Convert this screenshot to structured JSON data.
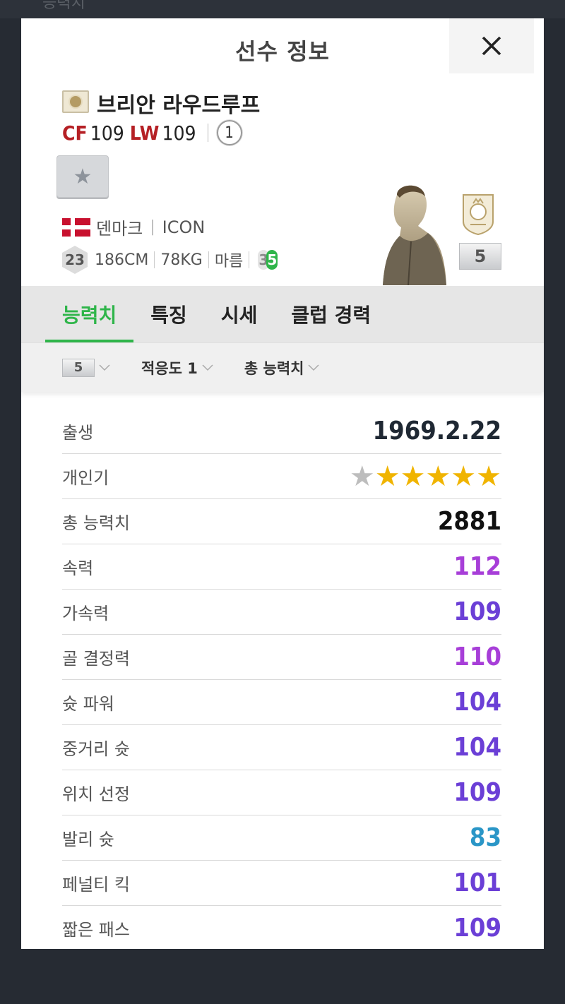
{
  "background": {
    "title_fragment": "능력치"
  },
  "modal": {
    "title": "선수 정보"
  },
  "player": {
    "name": "브리안 라우드루프",
    "positions": [
      {
        "pos": "CF",
        "ovr": "109"
      },
      {
        "pos": "LW",
        "ovr": "109"
      }
    ],
    "grade": "1",
    "nation": "덴마크",
    "card_type": "ICON",
    "age": "23",
    "height": "186CM",
    "weight": "78KG",
    "body_type": "마름",
    "weak_foot": "3",
    "strong_foot": "5",
    "upgrade_level": "5"
  },
  "tabs": [
    {
      "label": "능력치",
      "active": true
    },
    {
      "label": "특징",
      "active": false
    },
    {
      "label": "시세",
      "active": false
    },
    {
      "label": "클럽 경력",
      "active": false
    }
  ],
  "filters": {
    "level": "5",
    "adaptation": "적응도 1",
    "sort": "총 능력치"
  },
  "stats": [
    {
      "label": "출생",
      "value": "1969.2.22",
      "color": "#1f2833"
    },
    {
      "label": "개인기",
      "stars_filled": 5,
      "stars_total": 6
    },
    {
      "label": "총 능력치",
      "value": "2881",
      "color": "#111111"
    },
    {
      "label": "속력",
      "value": "112",
      "color": "#a73ed8"
    },
    {
      "label": "가속력",
      "value": "109",
      "color": "#6b3fd6"
    },
    {
      "label": "골 결정력",
      "value": "110",
      "color": "#a73ed8"
    },
    {
      "label": "슛 파워",
      "value": "104",
      "color": "#6b3fd6"
    },
    {
      "label": "중거리 슛",
      "value": "104",
      "color": "#6b3fd6"
    },
    {
      "label": "위치 선정",
      "value": "109",
      "color": "#6b3fd6"
    },
    {
      "label": "발리 슛",
      "value": "83",
      "color": "#2a96c7"
    },
    {
      "label": "페널티 킥",
      "value": "101",
      "color": "#6b3fd6"
    },
    {
      "label": "짧은 패스",
      "value": "109",
      "color": "#6b3fd6"
    }
  ],
  "colors": {
    "accent": "#2fb54a",
    "position": "#b52025",
    "star_filled": "#f0b400",
    "star_empty": "#bdbdbd"
  }
}
